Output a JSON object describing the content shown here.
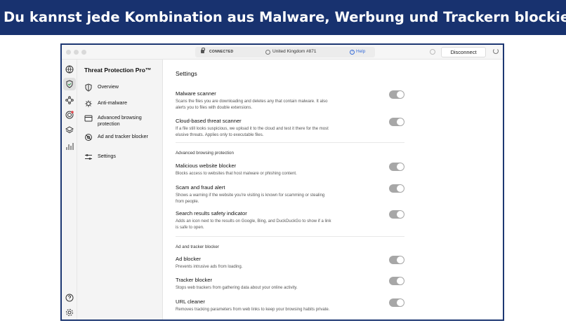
{
  "banner": {
    "text": "Du kannst jede Kombination aus Malware, Werbung und Trackern blockieren"
  },
  "titlebar": {
    "status": "CONNECTED",
    "server": "United Kingdom #871",
    "help": "Help",
    "disconnect": "Disconnect"
  },
  "rail": {
    "icons": [
      "globe-icon",
      "shield-icon",
      "mesh-icon",
      "target-icon",
      "layers-icon",
      "stats-icon",
      "help-icon",
      "settings-icon"
    ]
  },
  "sidebar": {
    "title": "Threat Protection Pro™",
    "items": [
      {
        "label": "Overview",
        "icon": "shield-icon"
      },
      {
        "label": "Anti-malware",
        "icon": "bug-icon"
      },
      {
        "label": "Advanced browsing protection",
        "icon": "browser-icon"
      },
      {
        "label": "Ad and tracker blocker",
        "icon": "eye-off-icon"
      },
      {
        "label": "Settings",
        "icon": "sliders-icon"
      }
    ]
  },
  "settings": {
    "title": "Settings",
    "malware_scanner": {
      "title": "Malware scanner",
      "desc": "Scans the files you are downloading and deletes any that contain malware. It also alerts you to files with double extensions."
    },
    "cloud_scanner": {
      "title": "Cloud-based threat scanner",
      "desc": "If a file still looks suspicious, we upload it to the cloud and test it there for the most elusive threats. Applies only to executable files."
    },
    "section_browsing": "Advanced browsing protection",
    "malicious_blocker": {
      "title": "Malicious website blocker",
      "desc": "Blocks access to websites that host malware or phishing content."
    },
    "scam_alert": {
      "title": "Scam and fraud alert",
      "desc": "Shows a warning if the website you're visiting is known for scamming or stealing from people."
    },
    "search_indicator": {
      "title": "Search results safety indicator",
      "desc": "Adds an icon next to the results on Google, Bing, and DuckDuckGo to show if a link is safe to open."
    },
    "section_ads": "Ad and tracker blocker",
    "ad_blocker": {
      "title": "Ad blocker",
      "desc": "Prevents intrusive ads from loading."
    },
    "tracker_blocker": {
      "title": "Tracker blocker",
      "desc": "Stops web trackers from gathering data about your online activity."
    },
    "url_cleaner": {
      "title": "URL cleaner",
      "desc": "Removes tracking parameters from web links to keep your browsing habits private."
    }
  },
  "colors": {
    "banner_bg": "#18326f",
    "toggle": "#a7a7a7",
    "link": "#3b6fd9"
  }
}
